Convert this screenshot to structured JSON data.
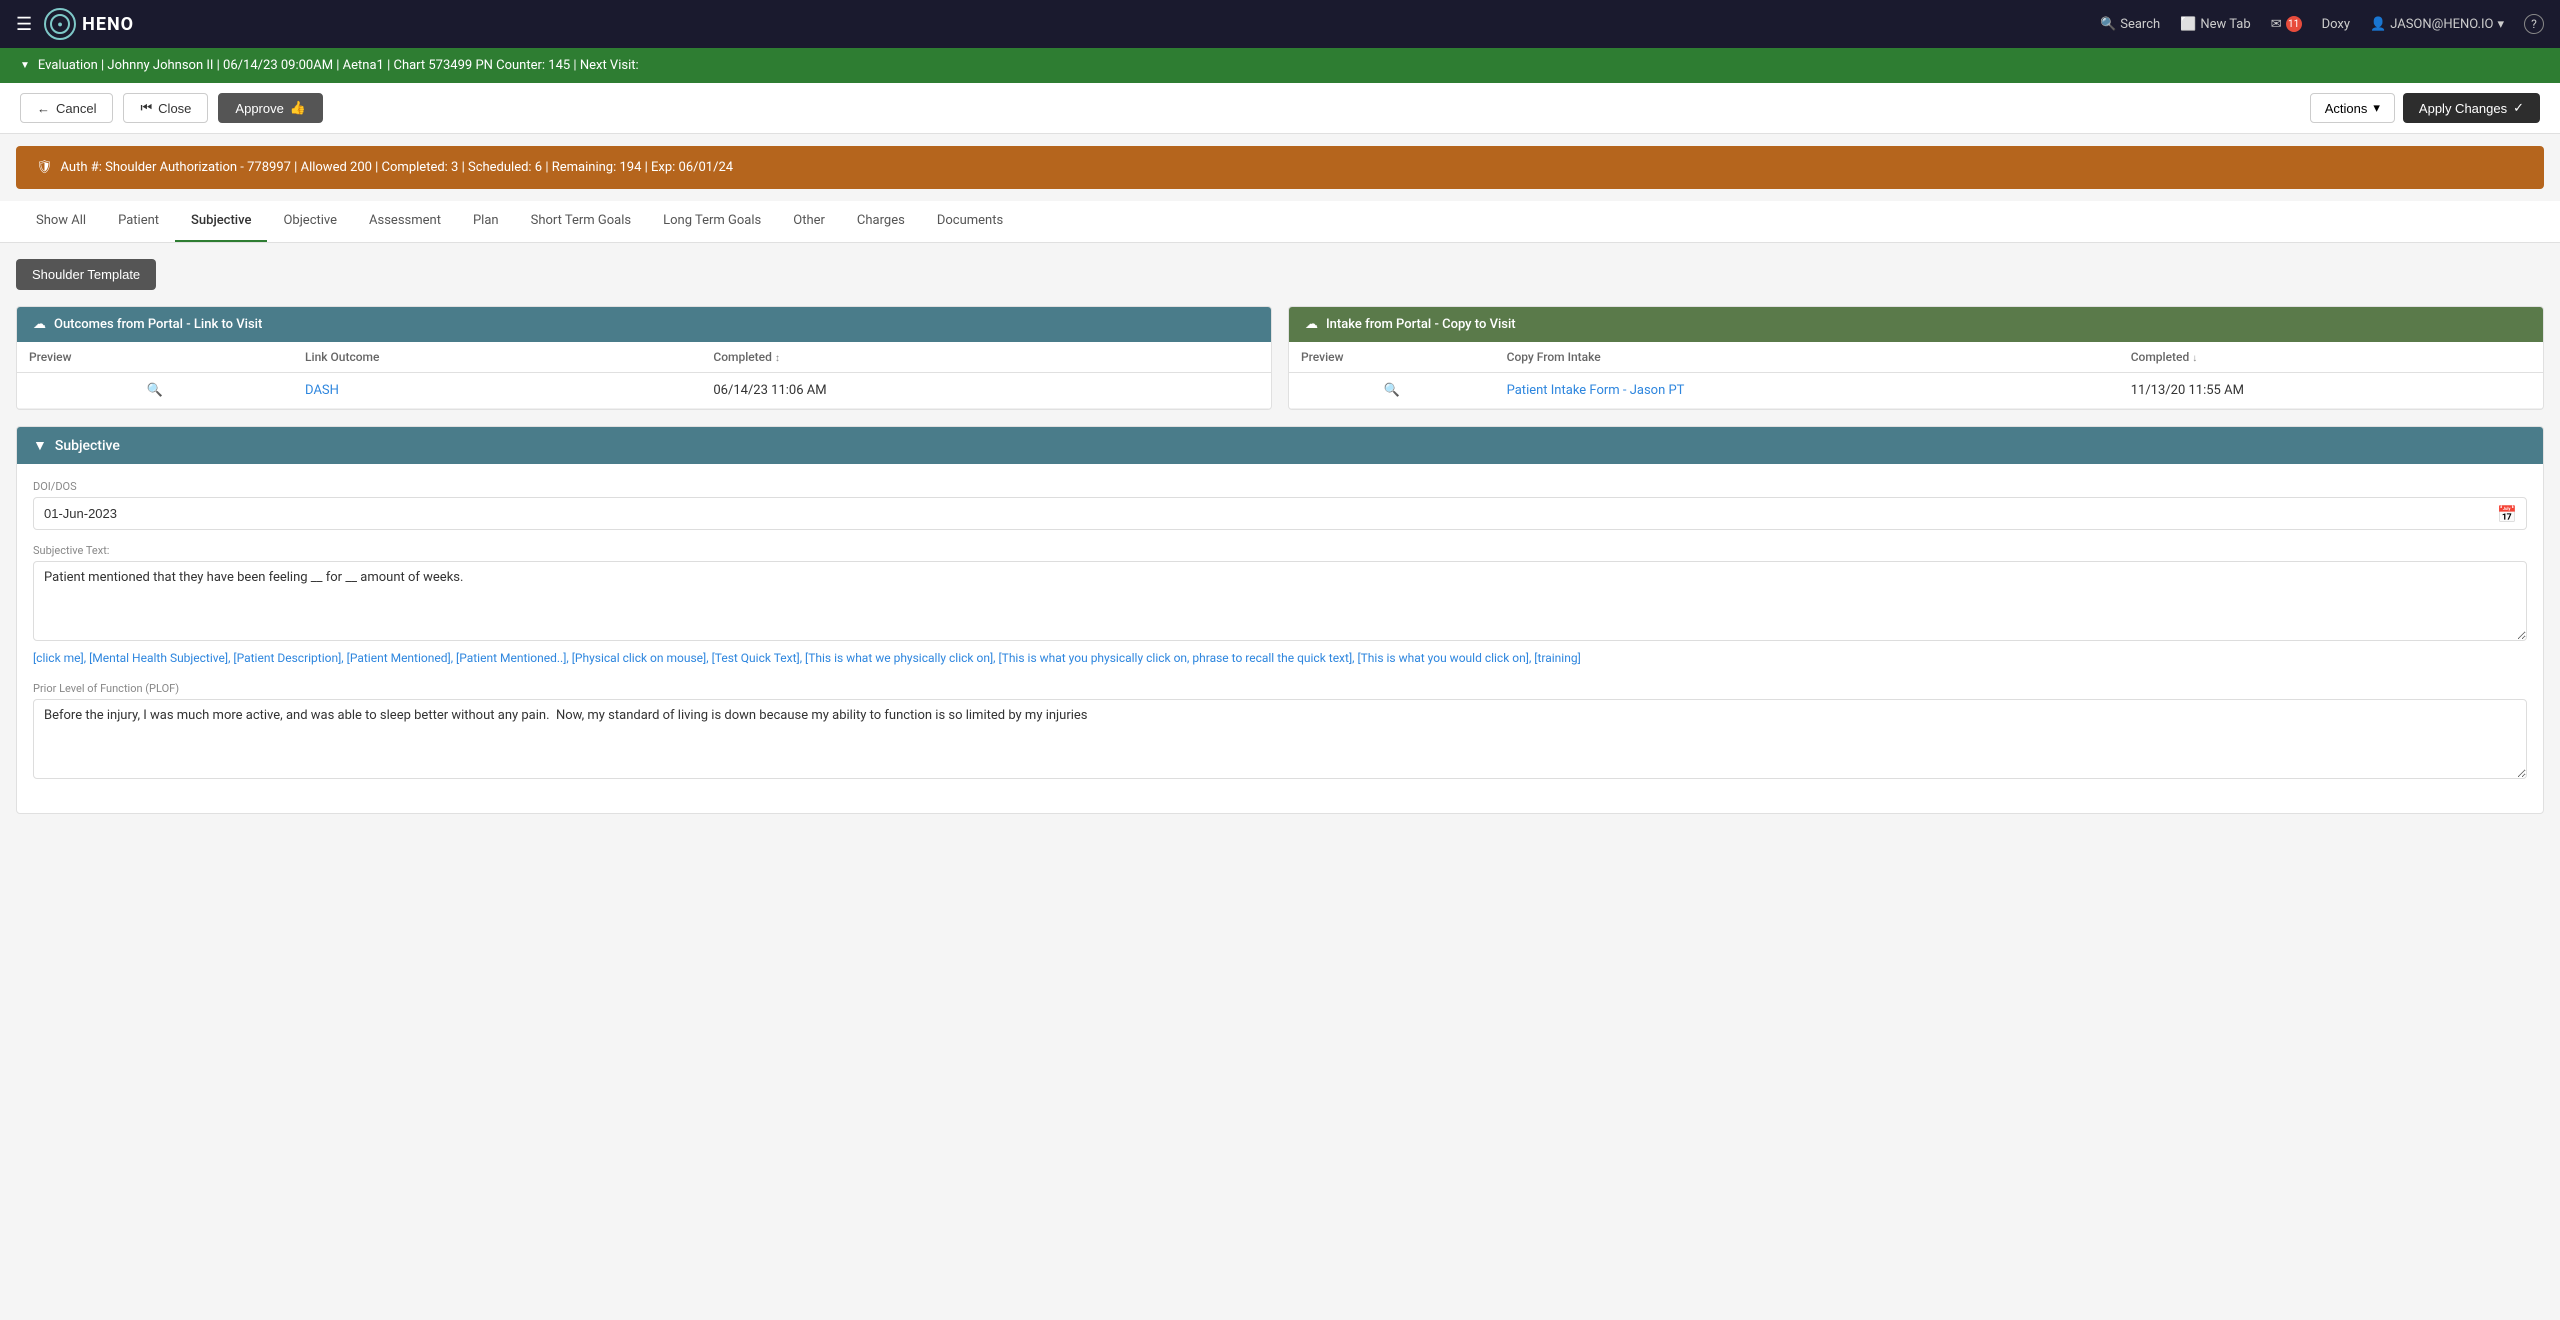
{
  "topNav": {
    "logoText": "HENO",
    "search": "Search",
    "newTab": "New Tab",
    "messages": "11",
    "doxy": "Doxy",
    "user": "JASON@HENO.IO",
    "helpIcon": "?"
  },
  "evalBanner": {
    "text": "Evaluation | Johnny Johnson II | 06/14/23 09:00AM | Aetna1 | Chart 573499 PN Counter: 145 | Next Visit:"
  },
  "toolbar": {
    "cancelLabel": "Cancel",
    "closeLabel": "Close",
    "approveLabel": "Approve",
    "actionsLabel": "Actions",
    "applyChangesLabel": "Apply Changes"
  },
  "authBanner": {
    "text": "Auth #: Shoulder Authorization - 778997 | Allowed 200 | Completed: 3 | Scheduled: 6 | Remaining: 194 | Exp: 06/01/24"
  },
  "tabs": [
    {
      "id": "show-all",
      "label": "Show All"
    },
    {
      "id": "patient",
      "label": "Patient"
    },
    {
      "id": "subjective",
      "label": "Subjective",
      "active": true
    },
    {
      "id": "objective",
      "label": "Objective"
    },
    {
      "id": "assessment",
      "label": "Assessment"
    },
    {
      "id": "plan",
      "label": "Plan"
    },
    {
      "id": "short-term-goals",
      "label": "Short Term Goals"
    },
    {
      "id": "long-term-goals",
      "label": "Long Term Goals"
    },
    {
      "id": "other",
      "label": "Other"
    },
    {
      "id": "charges",
      "label": "Charges"
    },
    {
      "id": "documents",
      "label": "Documents"
    }
  ],
  "templateButton": {
    "label": "Shoulder Template"
  },
  "outcomesPortal": {
    "title": "Outcomes from Portal - Link to Visit",
    "columns": {
      "preview": "Preview",
      "linkOutcome": "Link Outcome",
      "completed": "Completed"
    },
    "rows": [
      {
        "preview": "🔍",
        "linkOutcome": "DASH",
        "completed": "06/14/23 11:06 AM"
      }
    ]
  },
  "intakePortal": {
    "title": "Intake from Portal - Copy to Visit",
    "columns": {
      "preview": "Preview",
      "copyFromIntake": "Copy From Intake",
      "completed": "Completed"
    },
    "rows": [
      {
        "preview": "🔍",
        "copyFromIntake": "Patient Intake Form - Jason PT",
        "completed": "11/13/20 11:55 AM"
      }
    ]
  },
  "subjectiveSection": {
    "title": "Subjective",
    "doiDosLabel": "DOI/DOS",
    "doiDosValue": "01-Jun-2023",
    "subjectiveTextLabel": "Subjective Text:",
    "subjectiveTextValue": "Patient mentioned that they have been feeling __ for __ amount of weeks.",
    "quickLinks": [
      "[click me]",
      "[Mental Health Subjective]",
      "[Patient Description]",
      "[Patient Mentioned]",
      "[Patient Mentioned..]",
      "[Physical click on mouse]",
      "[Test Quick Text]",
      "[This is what we physically click on]",
      "[This is what you physically click on, phrase to recall the quick text]",
      "[This is what you would click on]",
      "[training]"
    ],
    "plofLabel": "Prior Level of Function (PLOF)",
    "plofValue": "Before the injury, I was much more active, and was able to sleep better without any pain.  Now, my standard of living is down because my ability to function is so limited by my injuries"
  }
}
